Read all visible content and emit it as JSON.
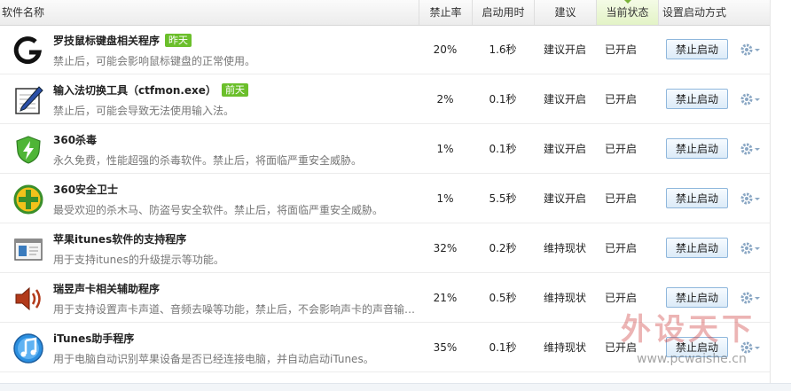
{
  "header": {
    "name": "软件名称",
    "rate": "禁止率",
    "time": "启动用时",
    "advice": "建议",
    "state": "当前状态",
    "mode": "设置启动方式"
  },
  "rows": [
    {
      "name": "罗技鼠标键盘相关程序",
      "badge": "昨天",
      "desc": "禁止后，可能会影响鼠标键盘的正常使用。",
      "rate": "20%",
      "time": "1.6秒",
      "advice": "建议开启",
      "state": "已开启",
      "button": "禁止启动",
      "icon": "logitech-g-icon"
    },
    {
      "name": "输入法切换工具（ctfmon.exe）",
      "badge": "前天",
      "desc": "禁止后，可能会导致无法使用输入法。",
      "rate": "2%",
      "time": "0.1秒",
      "advice": "建议开启",
      "state": "已开启",
      "button": "禁止启动",
      "icon": "pen-notepad-icon"
    },
    {
      "name": "360杀毒",
      "badge": "",
      "desc": "永久免费，性能超强的杀毒软件。禁止后，将面临严重安全威胁。",
      "rate": "1%",
      "time": "0.1秒",
      "advice": "建议开启",
      "state": "已开启",
      "button": "禁止启动",
      "icon": "shield-lightning-icon"
    },
    {
      "name": "360安全卫士",
      "badge": "",
      "desc": "最受欢迎的杀木马、防盗号安全软件。禁止后，将面临严重安全威胁。",
      "rate": "1%",
      "time": "5.5秒",
      "advice": "建议开启",
      "state": "已开启",
      "button": "禁止启动",
      "icon": "plus-circle-icon"
    },
    {
      "name": "苹果itunes软件的支持程序",
      "badge": "",
      "desc": "用于支持itunes的升级提示等功能。",
      "rate": "32%",
      "time": "0.2秒",
      "advice": "维持现状",
      "state": "已开启",
      "button": "禁止启动",
      "icon": "window-app-icon"
    },
    {
      "name": "瑞昱声卡相关辅助程序",
      "badge": "",
      "desc": "用于支持设置声卡声道、音频去噪等功能，禁止后，不会影响声卡的声音输出。",
      "rate": "21%",
      "time": "0.5秒",
      "advice": "维持现状",
      "state": "已开启",
      "button": "禁止启动",
      "icon": "speaker-icon"
    },
    {
      "name": "iTunes助手程序",
      "badge": "",
      "desc": "用于电脑自动识别苹果设备是否已经连接电脑，并自动启动iTunes。",
      "rate": "35%",
      "time": "0.1秒",
      "advice": "维持现状",
      "state": "已开启",
      "button": "禁止启动",
      "icon": "itunes-note-icon"
    }
  ],
  "watermark": {
    "text": "外设天下",
    "url": "www.pcwaishe.cn"
  }
}
